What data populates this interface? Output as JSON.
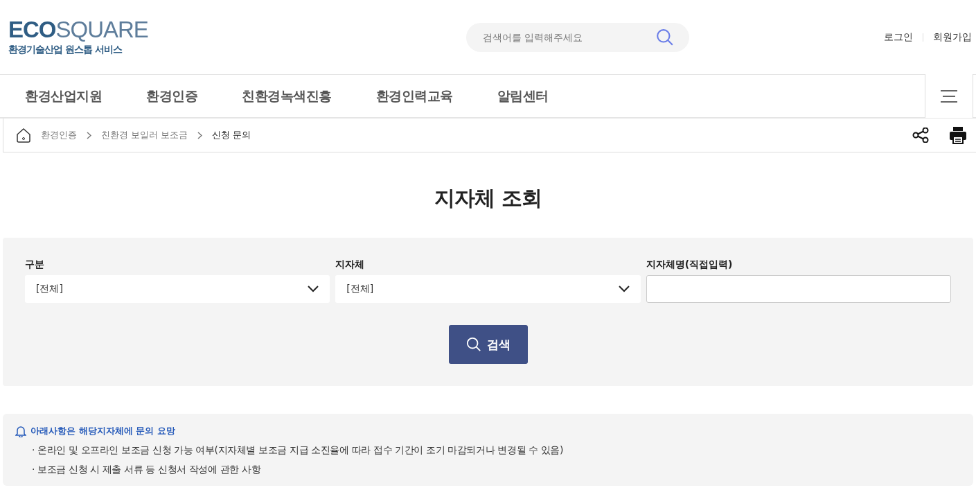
{
  "logo": {
    "brand_bold": "ECO",
    "brand_light": "SQUARE",
    "tagline": "환경기술산업 원스톱 서비스"
  },
  "search": {
    "placeholder": "검색어를 입력해주세요"
  },
  "user_links": [
    "로그인",
    "회원가입"
  ],
  "nav": [
    "환경산업지원",
    "환경인증",
    "친환경녹색진흥",
    "환경인력교육",
    "알림센터"
  ],
  "breadcrumb": [
    "환경인증",
    "친환경 보일러 보조금",
    "신청 문의"
  ],
  "page_title": "지자체 조회",
  "filters": [
    {
      "kind": "select",
      "label": "구분",
      "value": "[전체]"
    },
    {
      "kind": "select",
      "label": "지자체",
      "value": "[전체]"
    },
    {
      "kind": "input",
      "label": "지자체명(직접입력)"
    }
  ],
  "search_button": "검색",
  "notice": {
    "title": "아래사항은 해당지자체에 문의 요망",
    "items": [
      "· 온라인 및 오프라인 보조금 신청 가능 여부(지자체별 보조금 지급 소진율에 따라 접수 기간이 조기 마감되거나 변경될 수 있음)",
      "· 보조금 신청 시 제출 서류 등 신청서 작성에 관한 사항"
    ]
  }
}
